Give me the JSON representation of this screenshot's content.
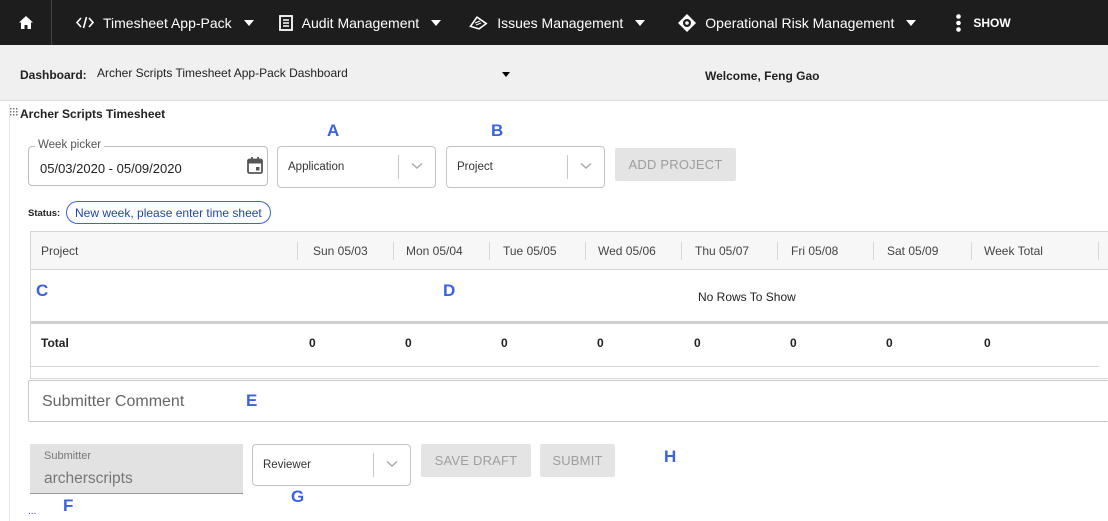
{
  "nav": {
    "items": [
      {
        "label": "Timesheet App-Pack",
        "icon": "code-icon"
      },
      {
        "label": "Audit Management",
        "icon": "document-icon"
      },
      {
        "label": "Issues Management",
        "icon": "ticket-icon"
      },
      {
        "label": "Operational Risk Management",
        "icon": "target-icon"
      }
    ],
    "show_more": "SHOW"
  },
  "dashboard": {
    "label": "Dashboard:",
    "selected": "Archer Scripts Timesheet App-Pack Dashboard",
    "welcome": "Welcome, Feng Gao"
  },
  "panel": {
    "title": "Archer Scripts Timesheet",
    "week_picker": {
      "label": "Week picker",
      "value": "05/03/2020 - 05/09/2020"
    },
    "application_placeholder": "Application",
    "project_placeholder": "Project",
    "add_project": "ADD PROJECT",
    "status_label": "Status:",
    "status_text": "New week, please enter time sheet"
  },
  "annotations": {
    "A": "A",
    "B": "B",
    "C": "C",
    "D": "D",
    "E": "E",
    "F": "F",
    "G": "G",
    "H": "H"
  },
  "grid": {
    "columns": [
      "Project",
      "Sun 05/03",
      "Mon 05/04",
      "Tue 05/05",
      "Wed 05/06",
      "Thu 05/07",
      "Fri 05/08",
      "Sat 05/09",
      "Week Total"
    ],
    "empty_text": "No Rows To Show",
    "total_label": "Total",
    "totals": [
      "0",
      "0",
      "0",
      "0",
      "0",
      "0",
      "0",
      "0"
    ]
  },
  "comment_placeholder": "Submitter Comment",
  "submitter": {
    "label": "Submitter",
    "value": "archerscripts"
  },
  "reviewer_placeholder": "Reviewer",
  "buttons": {
    "save_draft": "SAVE DRAFT",
    "submit": "SUBMIT"
  },
  "footer_dots": "..."
}
